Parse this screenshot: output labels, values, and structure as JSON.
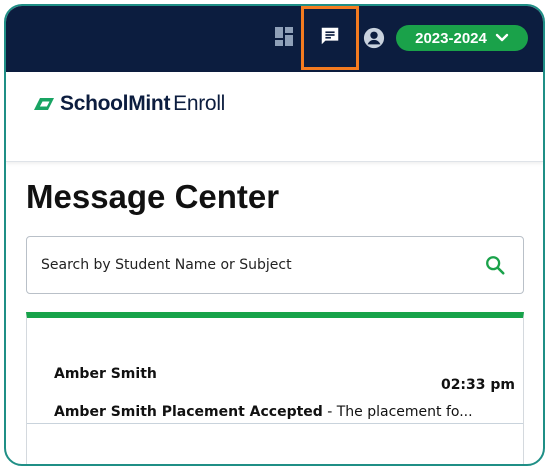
{
  "header": {
    "year_selector": "2023-2024",
    "icons": [
      "dashboard-icon",
      "messages-icon",
      "profile-icon",
      "chevron-down-icon"
    ],
    "colors": {
      "navbar": "#0c1d3f",
      "highlight": "#f47b20",
      "accent": "#1aa24a"
    }
  },
  "brand": {
    "name": "SchoolMint",
    "product": "Enroll"
  },
  "main": {
    "title": "Message Center",
    "search": {
      "placeholder": "Search by Student Name or Subject",
      "value": ""
    },
    "messages": [
      {
        "sender": "Amber Smith",
        "time": "02:33 pm",
        "subject": "Amber Smith Placement Accepted",
        "preview": " - The placement fo..."
      }
    ]
  }
}
